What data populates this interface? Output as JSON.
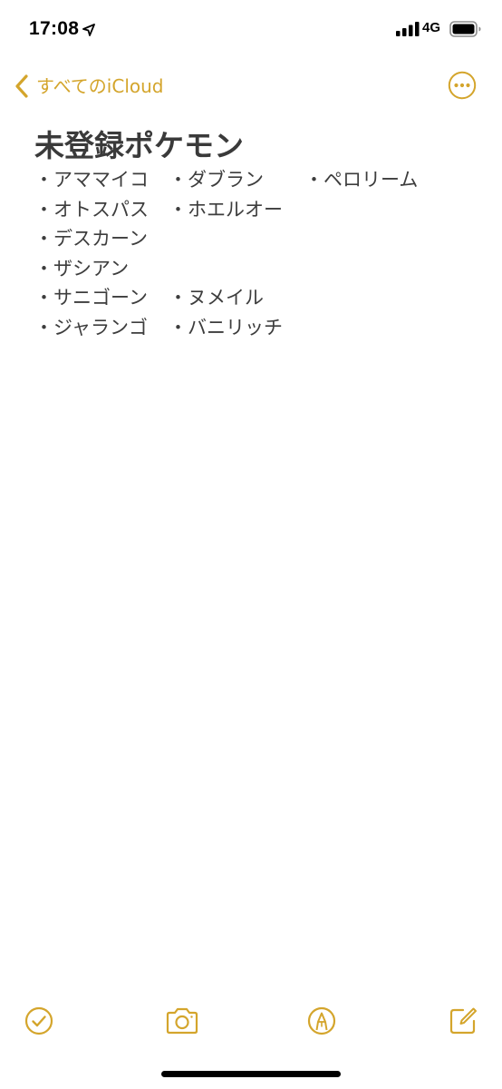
{
  "status_bar": {
    "time": "17:08",
    "network": "4G",
    "location_icon": "location-arrow-icon",
    "signal_icon": "cellular-signal-icon",
    "battery_icon": "battery-icon"
  },
  "nav": {
    "back_label": "すべてのiCloud",
    "back_icon": "chevron-left-icon",
    "more_icon": "ellipsis-circle-icon"
  },
  "note": {
    "title": "未登録ポケモン",
    "columns": [
      [
        "・アママイコ",
        "・オトスパス",
        "・デスカーン",
        "・ザシアン",
        "・サニゴーン",
        "・ジャランゴ"
      ],
      [
        "・ダブラン",
        "・ホエルオー",
        "",
        "",
        "・ヌメイル",
        "・バニリッチ"
      ],
      [
        "・ペロリーム"
      ]
    ]
  },
  "toolbar": {
    "checklist_icon": "checklist-icon",
    "camera_icon": "camera-icon",
    "markup_icon": "markup-pen-icon",
    "compose_icon": "compose-icon"
  },
  "colors": {
    "accent": "#d4a52c",
    "text": "#3d3d3d",
    "background": "#ffffff"
  }
}
